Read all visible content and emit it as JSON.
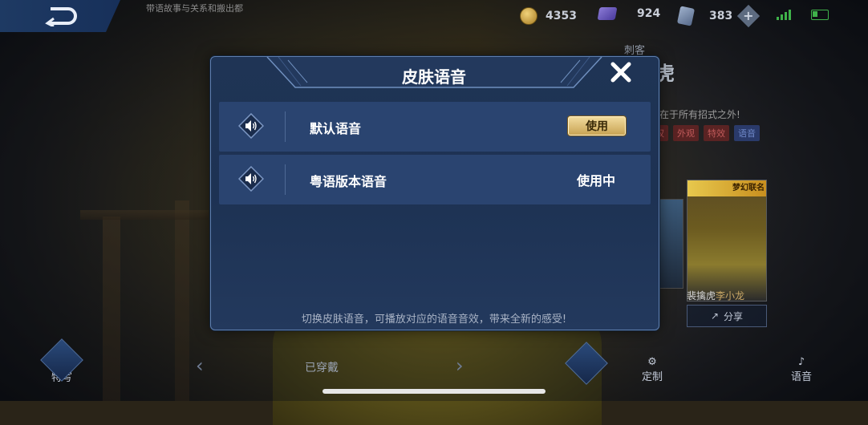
{
  "topbar": {
    "hint": "带语故事与关系和搬出都",
    "currencies": [
      {
        "icon": "gold-coin-icon",
        "value": "4353"
      },
      {
        "icon": "diamond-gem-icon",
        "value": "924"
      },
      {
        "icon": "ticket-icon",
        "value": "383"
      }
    ]
  },
  "hero": {
    "role": "刺客",
    "name": "虎",
    "desc": "存在于所有招式之外!",
    "tags": [
      "权",
      "外观",
      "特效",
      "语音"
    ]
  },
  "skin": {
    "name": "裴擒虎",
    "name_suffix": "李小龙",
    "share_label": "分享",
    "card_banner": "梦幻联名"
  },
  "bottom": {
    "special_label": "特写",
    "worn_label": "已穿戴",
    "custom_label": "定制",
    "voice_label": "语音"
  },
  "modal": {
    "title": "皮肤语音",
    "rows": [
      {
        "name": "默认语音",
        "action": "使用"
      },
      {
        "name": "粤语版本语音",
        "status": "使用中"
      }
    ],
    "footer": "切换皮肤语音，可播放对应的语音音效，带来全新的感受!"
  },
  "colors": {
    "modal_bg": "#1f3455",
    "row_bg": "#2a4470",
    "gold_button": "#e6c57a",
    "accent_blue": "#5f7fae"
  }
}
